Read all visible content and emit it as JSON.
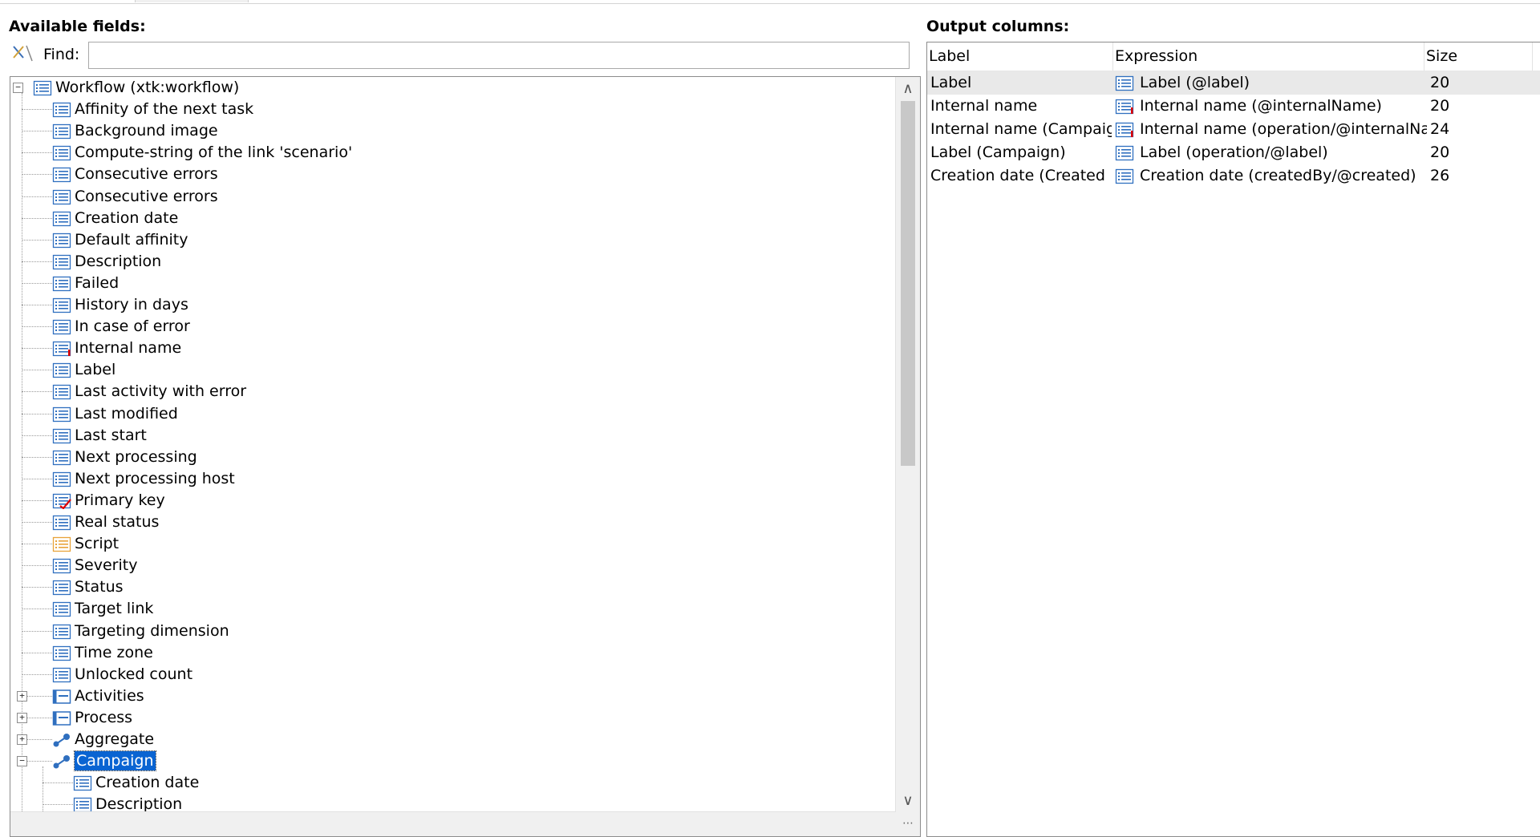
{
  "available_fields_label": "Available fields:",
  "output_columns_label": "Output columns:",
  "find": {
    "label": "Find:",
    "value": ""
  },
  "tree": {
    "items": [
      {
        "level": 0,
        "label": "Workflow (xtk:workflow)",
        "icon": "list-icon",
        "expander": "minus"
      },
      {
        "level": 1,
        "label": "Affinity of the next task",
        "icon": "field-icon"
      },
      {
        "level": 1,
        "label": "Background image",
        "icon": "field-icon"
      },
      {
        "level": 1,
        "label": "Compute-string of the link 'scenario'",
        "icon": "field-icon"
      },
      {
        "level": 1,
        "label": "Consecutive errors",
        "icon": "field-icon"
      },
      {
        "level": 1,
        "label": "Consecutive errors",
        "icon": "field-icon"
      },
      {
        "level": 1,
        "label": "Creation date",
        "icon": "field-icon"
      },
      {
        "level": 1,
        "label": "Default affinity",
        "icon": "field-icon"
      },
      {
        "level": 1,
        "label": "Description",
        "icon": "field-icon"
      },
      {
        "level": 1,
        "label": "Failed",
        "icon": "field-icon"
      },
      {
        "level": 1,
        "label": "History in days",
        "icon": "field-icon"
      },
      {
        "level": 1,
        "label": "In case of error",
        "icon": "field-icon"
      },
      {
        "level": 1,
        "label": "Internal name",
        "icon": "field-mandatory-icon"
      },
      {
        "level": 1,
        "label": "Label",
        "icon": "field-icon"
      },
      {
        "level": 1,
        "label": "Last activity with error",
        "icon": "field-icon"
      },
      {
        "level": 1,
        "label": "Last modified",
        "icon": "field-icon"
      },
      {
        "level": 1,
        "label": "Last start",
        "icon": "field-icon"
      },
      {
        "level": 1,
        "label": "Next processing",
        "icon": "field-icon"
      },
      {
        "level": 1,
        "label": "Next processing host",
        "icon": "field-icon"
      },
      {
        "level": 1,
        "label": "Primary key",
        "icon": "primary-key-icon"
      },
      {
        "level": 1,
        "label": "Real status",
        "icon": "field-icon"
      },
      {
        "level": 1,
        "label": "Script",
        "icon": "script-icon"
      },
      {
        "level": 1,
        "label": "Severity",
        "icon": "field-icon"
      },
      {
        "level": 1,
        "label": "Status",
        "icon": "field-icon"
      },
      {
        "level": 1,
        "label": "Target link",
        "icon": "field-icon"
      },
      {
        "level": 1,
        "label": "Targeting dimension",
        "icon": "field-icon"
      },
      {
        "level": 1,
        "label": "Time zone",
        "icon": "field-icon"
      },
      {
        "level": 1,
        "label": "Unlocked count",
        "icon": "field-icon"
      },
      {
        "level": 1,
        "label": "Activities",
        "icon": "collection-icon",
        "expander": "plus"
      },
      {
        "level": 1,
        "label": "Process",
        "icon": "collection-icon",
        "expander": "plus"
      },
      {
        "level": 1,
        "label": "Aggregate",
        "icon": "link-icon",
        "expander": "plus"
      },
      {
        "level": 1,
        "label": "Campaign",
        "icon": "link-icon",
        "expander": "minus",
        "selected": true
      },
      {
        "level": 2,
        "label": "Creation date",
        "icon": "field-icon"
      },
      {
        "level": 2,
        "label": "Description",
        "icon": "field-icon"
      }
    ]
  },
  "output_columns": {
    "headers": {
      "label": "Label",
      "expression": "Expression",
      "size": "Size"
    },
    "rows": [
      {
        "label": "Label",
        "expression": "Label (@label)",
        "size": "20",
        "icon": "field-icon",
        "selected": true
      },
      {
        "label": "Internal name",
        "expression": "Internal name (@internalName)",
        "size": "20",
        "icon": "field-mandatory-icon"
      },
      {
        "label": "Internal name (Campaig...",
        "expression": "Internal name (operation/@internalNa...",
        "size": "24",
        "icon": "field-mandatory-icon"
      },
      {
        "label": "Label (Campaign)",
        "expression": "Label (operation/@label)",
        "size": "20",
        "icon": "field-icon"
      },
      {
        "label": "Creation date (Created ...",
        "expression": "Creation date (createdBy/@created)",
        "size": "26",
        "icon": "field-icon"
      }
    ]
  },
  "colors": {
    "selection": "#0a64d2",
    "field_icon": "#2f6fbf",
    "mandatory": "#e00000",
    "script_icon": "#e8a33a"
  }
}
